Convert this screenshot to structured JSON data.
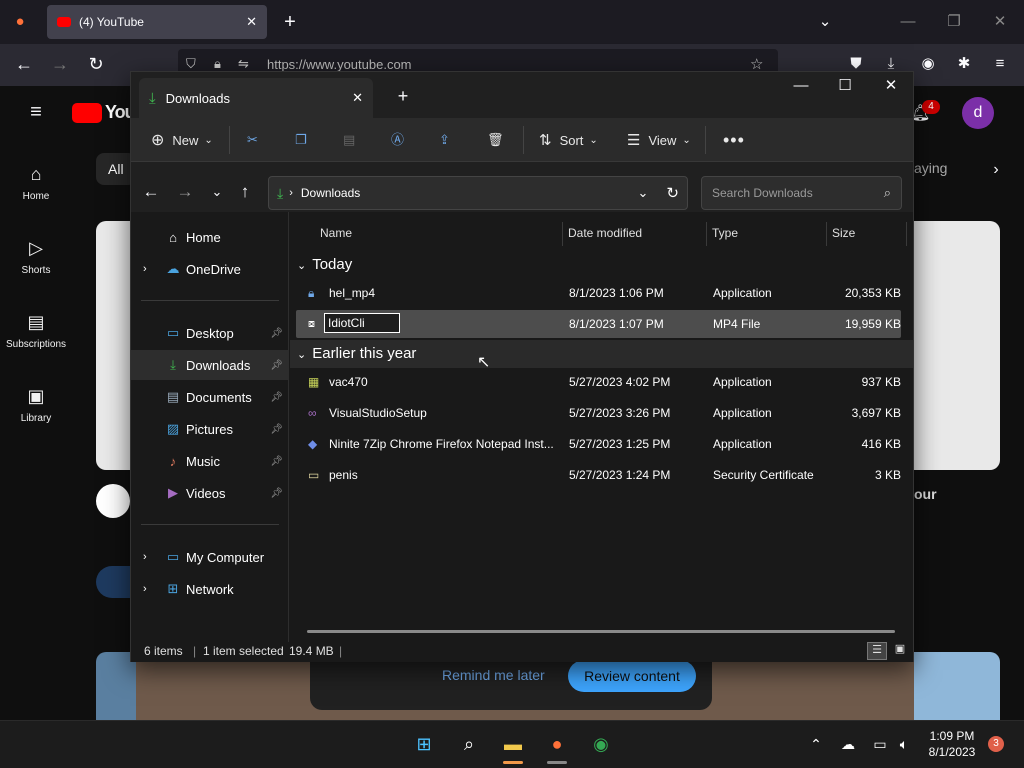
{
  "browser": {
    "tab_title": "(4) YouTube",
    "url": "https://www.youtube.com"
  },
  "youtube": {
    "sidebar": [
      {
        "label": "Home"
      },
      {
        "label": "Shorts"
      },
      {
        "label": "Subscriptions"
      },
      {
        "label": "Library"
      }
    ],
    "chip_all": "All",
    "chip_right": "aying",
    "partial_text": "our",
    "notification_count": "4",
    "avatar_letter": "d",
    "dialog": {
      "remind_label": "Remind me later",
      "review_label": "Review content"
    }
  },
  "explorer": {
    "tab_title": "Downloads",
    "toolbar": {
      "new_label": "New",
      "sort_label": "Sort",
      "view_label": "View"
    },
    "address": "Downloads",
    "search_placeholder": "Search Downloads",
    "nav": {
      "home": "Home",
      "onedrive": "OneDrive",
      "desktop": "Desktop",
      "downloads": "Downloads",
      "documents": "Documents",
      "pictures": "Pictures",
      "music": "Music",
      "videos": "Videos",
      "my_computer": "My Computer",
      "network": "Network"
    },
    "columns": {
      "name": "Name",
      "date": "Date modified",
      "type": "Type",
      "size": "Size"
    },
    "groups": {
      "today": "Today",
      "earlier": "Earlier this year"
    },
    "files_today": [
      {
        "name": "hel_mp4",
        "date": "8/1/2023 1:06 PM",
        "type": "Application",
        "size": "20,353 KB"
      },
      {
        "name": "IdiotCli",
        "date": "8/1/2023 1:07 PM",
        "type": "MP4 File",
        "size": "19,959 KB"
      }
    ],
    "files_earlier": [
      {
        "name": "vac470",
        "date": "5/27/2023 4:02 PM",
        "type": "Application",
        "size": "937 KB"
      },
      {
        "name": "VisualStudioSetup",
        "date": "5/27/2023 3:26 PM",
        "type": "Application",
        "size": "3,697 KB"
      },
      {
        "name": "Ninite 7Zip Chrome Firefox Notepad Inst...",
        "date": "5/27/2023 1:25 PM",
        "type": "Application",
        "size": "416 KB"
      },
      {
        "name": "penis",
        "date": "5/27/2023 1:24 PM",
        "type": "Security Certificate",
        "size": "3 KB"
      }
    ],
    "status": {
      "items": "6 items",
      "selected": "1 item selected",
      "size": "19.4 MB"
    }
  },
  "taskbar": {
    "time": "1:09 PM",
    "date": "8/1/2023",
    "badge": "3"
  },
  "colors": {
    "explorer_bg": "#191919",
    "selection": "#4d4d4d",
    "accent_green": "#3fb950",
    "youtube_red": "#ff0000",
    "avatar_purple": "#7b2fa8"
  }
}
